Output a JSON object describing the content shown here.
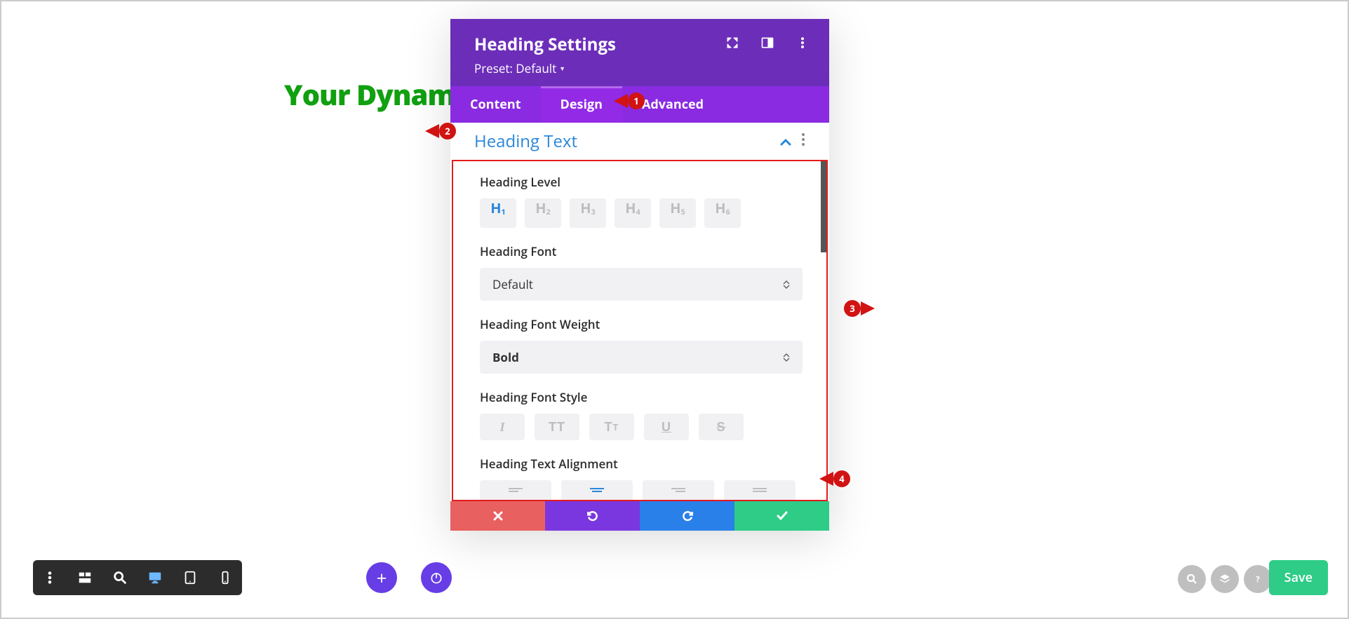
{
  "canvas": {
    "heading_text": "Your Dynami"
  },
  "modal": {
    "title": "Heading Settings",
    "preset_label": "Preset: Default",
    "tabs": {
      "content": "Content",
      "design": "Design",
      "advanced": "Advanced"
    },
    "section": "Heading Text",
    "labels": {
      "heading_level": "Heading Level",
      "heading_font": "Heading Font",
      "heading_font_weight": "Heading Font Weight",
      "heading_font_style": "Heading Font Style",
      "heading_text_alignment": "Heading Text Alignment"
    },
    "heading_levels": [
      "1",
      "2",
      "3",
      "4",
      "5",
      "6"
    ],
    "font_value": "Default",
    "font_weight_value": "Bold",
    "style_options": {
      "italic": "I",
      "uppercase": "TT",
      "smallcaps_big": "T",
      "smallcaps_small": "T",
      "underline": "U",
      "strike": "S"
    }
  },
  "markers": {
    "m1": "1",
    "m2": "2",
    "m3": "3",
    "m4": "4"
  },
  "footer": {
    "save": "Save"
  },
  "icons": {
    "expand": "expand-icon",
    "split": "split-view-icon",
    "more": "more-icon",
    "caret_up": "^",
    "plus": "+",
    "power": "power-icon",
    "search": "search-icon",
    "layers": "layers-icon",
    "help": "help-icon",
    "close": "×",
    "undo": "↺",
    "redo": "↻",
    "check": "✓",
    "menu": "menu-icon",
    "wireframe": "wireframe-icon",
    "zoom": "zoom-icon",
    "desktop": "desktop-icon",
    "tablet": "tablet-icon",
    "phone": "phone-icon"
  }
}
